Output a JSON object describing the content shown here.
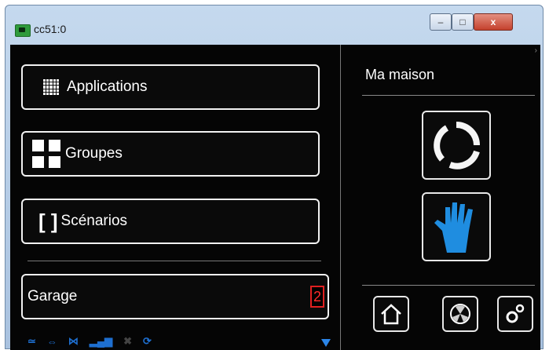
{
  "window": {
    "title": "cc51:0",
    "minimize_label": "–",
    "maximize_label": "□",
    "close_label": "x"
  },
  "menu": {
    "applications": "Applications",
    "groups": "Groupes",
    "scenarios": "Scénarios",
    "brackets": "[ ]",
    "garage": "Garage",
    "garage_badge": "2"
  },
  "right_panel": {
    "title": "Ma maison",
    "corner": "›"
  },
  "status_icons": [
    "network-icon",
    "link-icon",
    "bluetooth-icon",
    "signal-icon",
    "wifi-icon",
    "sync-icon"
  ],
  "colors": {
    "accent_blue": "#1e6fd0",
    "hand_blue": "#1f8de0",
    "badge_red": "#e02020"
  }
}
